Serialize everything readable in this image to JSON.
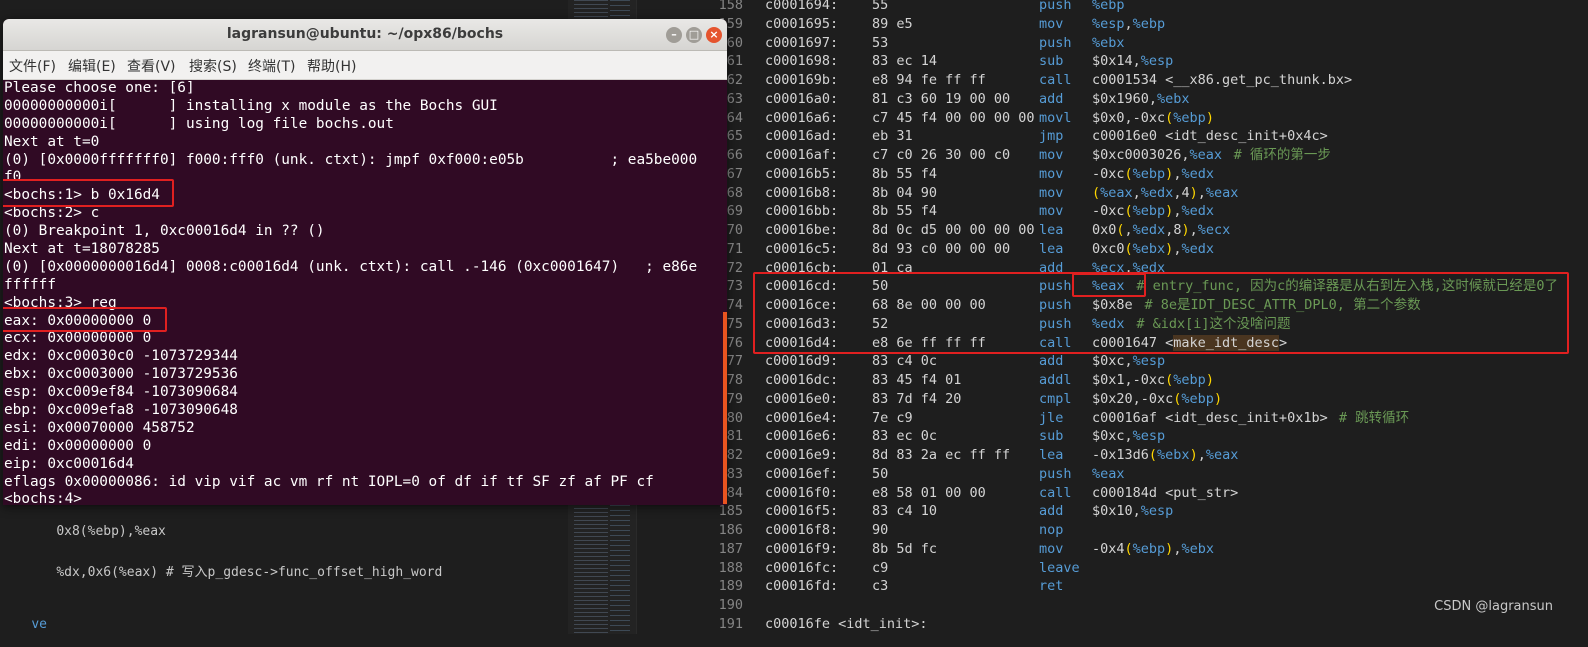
{
  "bg_left": {
    "line1": "0x8(%ebp),%eax",
    "line2": "%dx,0x6(%eax) # 写入p_gdesc->func_offset_high_word",
    "line3": "ve"
  },
  "asm": [
    {
      "n": "158",
      "addr": "c0001694:",
      "bytes": "55",
      "op": "push",
      "args": "%ebp",
      "comment": ""
    },
    {
      "n": "159",
      "addr": "c0001695:",
      "bytes": "89 e5",
      "op": "mov",
      "args": "%esp,%ebp",
      "comment": ""
    },
    {
      "n": "160",
      "addr": "c0001697:",
      "bytes": "53",
      "op": "push",
      "args": "%ebx",
      "comment": ""
    },
    {
      "n": "161",
      "addr": "c0001698:",
      "bytes": "83 ec 14",
      "op": "sub",
      "args": "$0x14,%esp",
      "comment": ""
    },
    {
      "n": "162",
      "addr": "c000169b:",
      "bytes": "e8 94 fe ff ff",
      "op": "call",
      "args": "c0001534 <__x86.get_pc_thunk.bx>",
      "comment": ""
    },
    {
      "n": "163",
      "addr": "c00016a0:",
      "bytes": "81 c3 60 19 00 00",
      "op": "add",
      "args": "$0x1960,%ebx",
      "comment": ""
    },
    {
      "n": "164",
      "addr": "c00016a6:",
      "bytes": "c7 45 f4 00 00 00 00",
      "op": "movl",
      "args": "$0x0,-0xc(%ebp)",
      "comment": ""
    },
    {
      "n": "165",
      "addr": "c00016ad:",
      "bytes": "eb 31",
      "op": "jmp",
      "args": "c00016e0 <idt_desc_init+0x4c>",
      "comment": ""
    },
    {
      "n": "166",
      "addr": "c00016af:",
      "bytes": "c7 c0 26 30 00 c0",
      "op": "mov",
      "args": "$0xc0003026,%eax",
      "comment": "# 循环的第一步"
    },
    {
      "n": "167",
      "addr": "c00016b5:",
      "bytes": "8b 55 f4",
      "op": "mov",
      "args": "-0xc(%ebp),%edx",
      "comment": ""
    },
    {
      "n": "168",
      "addr": "c00016b8:",
      "bytes": "8b 04 90",
      "op": "mov",
      "args": "(%eax,%edx,4),%eax",
      "comment": ""
    },
    {
      "n": "169",
      "addr": "c00016bb:",
      "bytes": "8b 55 f4",
      "op": "mov",
      "args": "-0xc(%ebp),%edx",
      "comment": ""
    },
    {
      "n": "170",
      "addr": "c00016be:",
      "bytes": "8d 0c d5 00 00 00 00",
      "op": "lea",
      "args": "0x0(,%edx,8),%ecx",
      "comment": ""
    },
    {
      "n": "171",
      "addr": "c00016c5:",
      "bytes": "8d 93 c0 00 00 00",
      "op": "lea",
      "args": "0xc0(%ebx),%edx",
      "comment": ""
    },
    {
      "n": "172",
      "addr": "c00016cb:",
      "bytes": "01 ca",
      "op": "add",
      "args": "%ecx,%edx",
      "comment": ""
    },
    {
      "n": "173",
      "addr": "c00016cd:",
      "bytes": "50",
      "op": "push",
      "args": "%eax",
      "comment": "# entry_func, 因为c的编译器是从右到左入栈,这时候就已经是0了"
    },
    {
      "n": "174",
      "addr": "c00016ce:",
      "bytes": "68 8e 00 00 00",
      "op": "push",
      "args": "$0x8e",
      "comment": "# 8e是IDT_DESC_ATTR_DPL0, 第二个参数"
    },
    {
      "n": "175",
      "addr": "c00016d3:",
      "bytes": "52",
      "op": "push",
      "args": "%edx",
      "comment": "# &idx[i]这个没啥问题"
    },
    {
      "n": "176",
      "addr": "c00016d4:",
      "bytes": "e8 6e ff ff ff",
      "op": "call",
      "args": "c0001647 <make_idt_desc>",
      "comment": ""
    },
    {
      "n": "177",
      "addr": "c00016d9:",
      "bytes": "83 c4 0c",
      "op": "add",
      "args": "$0xc,%esp",
      "comment": ""
    },
    {
      "n": "178",
      "addr": "c00016dc:",
      "bytes": "83 45 f4 01",
      "op": "addl",
      "args": "$0x1,-0xc(%ebp)",
      "comment": ""
    },
    {
      "n": "179",
      "addr": "c00016e0:",
      "bytes": "83 7d f4 20",
      "op": "cmpl",
      "args": "$0x20,-0xc(%ebp)",
      "comment": ""
    },
    {
      "n": "180",
      "addr": "c00016e4:",
      "bytes": "7e c9",
      "op": "jle",
      "args": "c00016af <idt_desc_init+0x1b>",
      "comment": "# 跳转循环"
    },
    {
      "n": "181",
      "addr": "c00016e6:",
      "bytes": "83 ec 0c",
      "op": "sub",
      "args": "$0xc,%esp",
      "comment": ""
    },
    {
      "n": "182",
      "addr": "c00016e9:",
      "bytes": "8d 83 2a ec ff ff",
      "op": "lea",
      "args": "-0x13d6(%ebx),%eax",
      "comment": ""
    },
    {
      "n": "183",
      "addr": "c00016ef:",
      "bytes": "50",
      "op": "push",
      "args": "%eax",
      "comment": ""
    },
    {
      "n": "184",
      "addr": "c00016f0:",
      "bytes": "e8 58 01 00 00",
      "op": "call",
      "args": "c000184d <put_str>",
      "comment": ""
    },
    {
      "n": "185",
      "addr": "c00016f5:",
      "bytes": "83 c4 10",
      "op": "add",
      "args": "$0x10,%esp",
      "comment": ""
    },
    {
      "n": "186",
      "addr": "c00016f8:",
      "bytes": "90",
      "op": "nop",
      "args": "",
      "comment": ""
    },
    {
      "n": "187",
      "addr": "c00016f9:",
      "bytes": "8b 5d fc",
      "op": "mov",
      "args": "-0x4(%ebp),%ebx",
      "comment": ""
    },
    {
      "n": "188",
      "addr": "c00016fc:",
      "bytes": "c9",
      "op": "leave",
      "args": "",
      "comment": ""
    },
    {
      "n": "189",
      "addr": "c00016fd:",
      "bytes": "c3",
      "op": "ret",
      "args": "",
      "comment": ""
    },
    {
      "n": "190",
      "addr": "",
      "bytes": "",
      "op": "",
      "args": "",
      "comment": ""
    },
    {
      "n": "191",
      "addr": "c00016fe <idt_init>:",
      "bytes": "",
      "op": "",
      "args": "",
      "comment": ""
    }
  ],
  "terminal": {
    "title": "lagransun@ubuntu: ~/opx86/bochs",
    "menu": [
      "文件(F)",
      "编辑(E)",
      "查看(V)",
      "搜索(S)",
      "终端(T)",
      "帮助(H)"
    ],
    "lines": [
      "Please choose one: [6]",
      "00000000000i[      ] installing x module as the Bochs GUI",
      "00000000000i[      ] using log file bochs.out",
      "Next at t=0",
      "(0) [0x0000fffffff0] f000:fff0 (unk. ctxt): jmpf 0xf000:e05b          ; ea5be000",
      "f0",
      "<bochs:1> b 0x16d4",
      "<bochs:2> c",
      "(0) Breakpoint 1, 0xc00016d4 in ?? ()",
      "Next at t=18078285",
      "(0) [0x0000000016d4] 0008:c00016d4 (unk. ctxt): call .-146 (0xc0001647)   ; e86e",
      "ffffff",
      "<bochs:3> reg",
      "eax: 0x00000000 0",
      "ecx: 0x00000000 0",
      "edx: 0xc00030c0 -1073729344",
      "ebx: 0xc0003000 -1073729536",
      "esp: 0xc009ef84 -1073090684",
      "ebp: 0xc009efa8 -1073090648",
      "esi: 0x00070000 458752",
      "edi: 0x00000000 0",
      "eip: 0xc00016d4",
      "eflags 0x00000086: id vip vif ac vm rf nt IOPL=0 of df if tf SF zf af PF cf",
      "<bochs:4>"
    ]
  },
  "watermark": "CSDN @lagransun",
  "colors": {
    "terminal_bg": "#300a24",
    "highlight_red": "#e02020",
    "editor_bg": "#1e1e1e",
    "comment": "#6a9955",
    "keyword": "#569cd6"
  }
}
